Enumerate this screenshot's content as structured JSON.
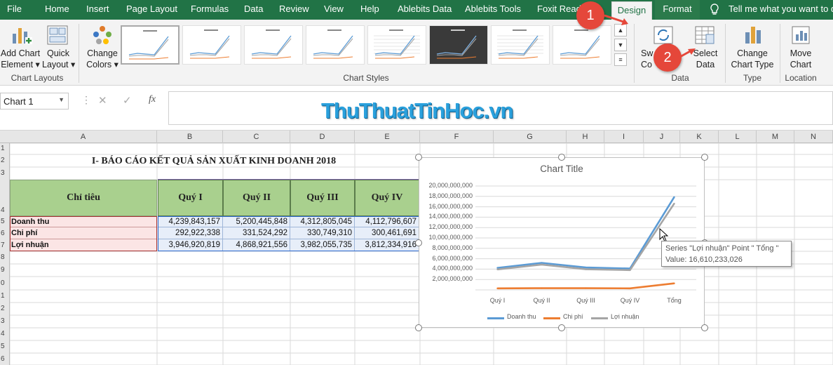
{
  "tabs": [
    "File",
    "Home",
    "Insert",
    "Page Layout",
    "Formulas",
    "Data",
    "Review",
    "View",
    "Help",
    "Ablebits Data",
    "Ablebits Tools",
    "Foxit Read",
    "Design",
    "Format"
  ],
  "tell_me": "Tell me what you want to do",
  "ribbon": {
    "add_chart_1": "Add Chart",
    "add_chart_2": "Element ▾",
    "quick_layout_1": "Quick",
    "quick_layout_2": "Layout ▾",
    "chart_layouts": "Chart Layouts",
    "change_colors_1": "Change",
    "change_colors_2": "Colors ▾",
    "chart_styles": "Chart Styles",
    "switch_1": "Sw",
    "switch_2": "Co",
    "select_data_1": "Select",
    "select_data_2": "Data",
    "data_group": "Data",
    "change_type_1": "Change",
    "change_type_2": "Chart Type",
    "type_group": "Type",
    "move_chart_1": "Move",
    "move_chart_2": "Chart",
    "location_group": "Location"
  },
  "formula_bar": {
    "name_box": "Chart 1",
    "fx": "fx",
    "watermark": "ThuThuatTinHoc.vn"
  },
  "columns": [
    "A",
    "B",
    "C",
    "D",
    "E",
    "F",
    "G",
    "H",
    "I",
    "J",
    "K",
    "L",
    "M",
    "N"
  ],
  "rows": [
    "1",
    "2",
    "3",
    "4",
    "5",
    "6",
    "7",
    "8",
    "9",
    "0",
    "1",
    "2",
    "3",
    "4",
    "5",
    "6"
  ],
  "sheet": {
    "title": "I- BÁO CÁO KẾT QUẢ SẢN XUẤT KINH DOANH 2018",
    "header_label": "Chỉ tiêu",
    "quarters": [
      "Quý I",
      "Quý II",
      "Quý III",
      "Quý IV"
    ],
    "data_rows": [
      {
        "label": "Doanh thu",
        "values": [
          "4,239,843,157",
          "5,200,445,848",
          "4,312,805,045",
          "4,112,796,607"
        ]
      },
      {
        "label": "Chi phí",
        "values": [
          "292,922,338",
          "331,524,292",
          "330,749,310",
          "300,461,691"
        ]
      },
      {
        "label": "Lợi nhuận",
        "values": [
          "3,946,920,819",
          "4,868,921,556",
          "3,982,055,735",
          "3,812,334,916"
        ]
      }
    ]
  },
  "chart_data": {
    "type": "line",
    "title": "Chart Title",
    "categories": [
      "Quý I",
      "Quý II",
      "Quý III",
      "Quý IV",
      "Tổng"
    ],
    "series": [
      {
        "name": "Doanh thu",
        "color": "#5b9bd5",
        "values": [
          4239843157,
          5200445848,
          4312805045,
          4112796607,
          17865890657
        ]
      },
      {
        "name": "Chi phí",
        "color": "#ed7d31",
        "values": [
          292922338,
          331524292,
          330749310,
          300461691,
          1255657631
        ]
      },
      {
        "name": "Lợi nhuận",
        "color": "#a5a5a5",
        "values": [
          3946920819,
          4868921556,
          3982055735,
          3812334916,
          16610233026
        ]
      }
    ],
    "y_ticks": [
      "2,000,000,000",
      "4,000,000,000",
      "6,000,000,000",
      "8,000,000,000",
      "10,000,000,000",
      "12,000,000,000",
      "14,000,000,000",
      "16,000,000,000",
      "18,000,000,000",
      "20,000,000,000"
    ],
    "ylim": [
      0,
      20000000000
    ],
    "legend_position": "bottom",
    "grid": true
  },
  "tooltip": {
    "line1": "Series \"Lợi nhuận\" Point \" Tổng \"",
    "line2": "Value: 16,610,233,026"
  },
  "badges": [
    "1",
    "2"
  ]
}
